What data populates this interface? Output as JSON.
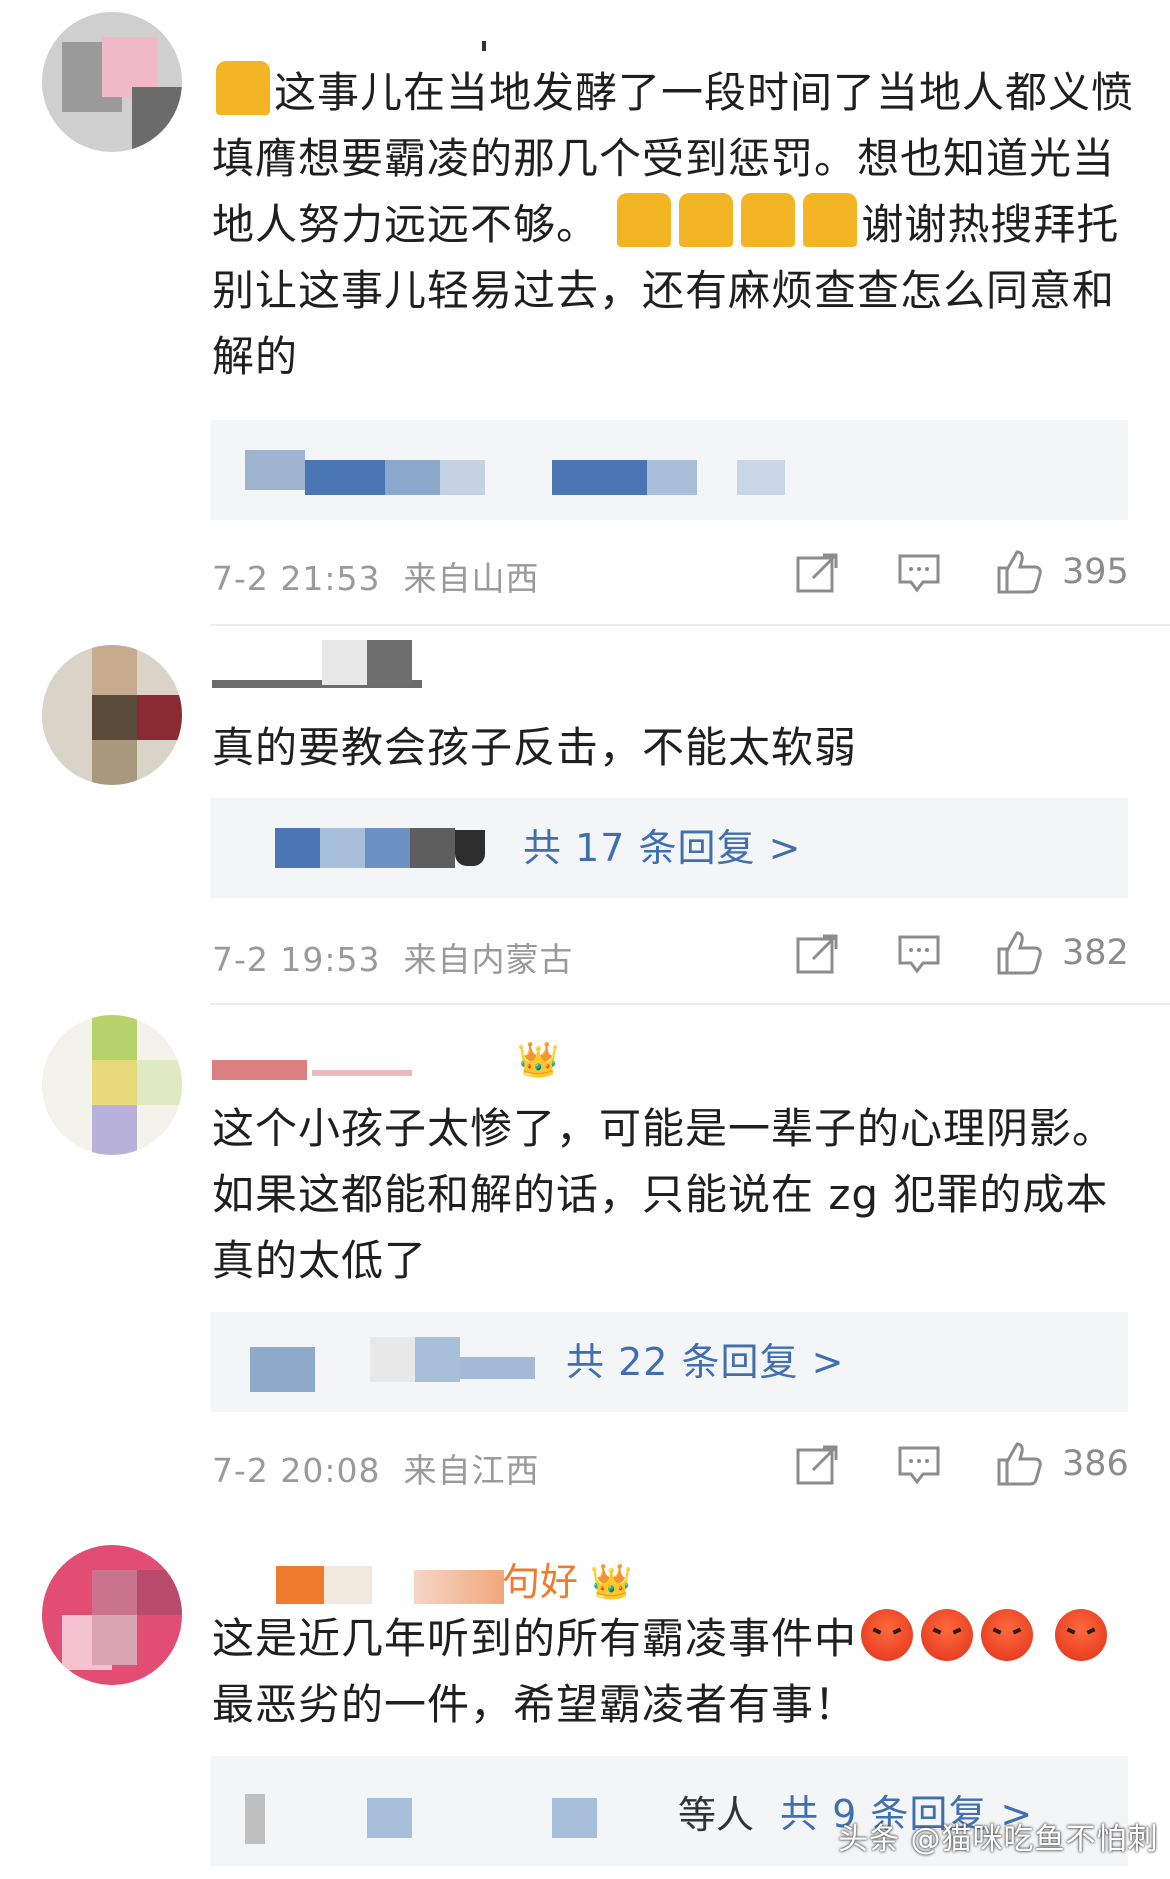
{
  "comments": [
    {
      "text_before_emoji": "",
      "text": "这事儿在当地发酵了一段时间了当地人都义愤填膺想要霸凌的那几个受到惩罚。想也知道光当地人努力远远不够。",
      "text_after": "谢谢热搜拜托别让这事儿轻易过去，还有麻烦查查怎么同意和解的",
      "reply_partial": "",
      "reply_link": "",
      "time": "7-2 21:53",
      "location": "来自山西",
      "likes": "395"
    },
    {
      "text": "真的要教会孩子反击，不能太软弱",
      "reply_link": "共 17 条回复 >",
      "time": "7-2 19:53",
      "location": "来自内蒙古",
      "likes": "382"
    },
    {
      "text": "这个小孩子太惨了，可能是一辈子的心理阴影。如果这都能和解的话，只能说在 zg 犯罪的成本真的太低了",
      "reply_link": "共 22 条回复 >",
      "time": "7-2 20:08",
      "location": "来自江西",
      "likes": "386"
    },
    {
      "username_partial": "句好",
      "text": "这是近几年听到的所有霸凌事件中",
      "text_after": "最恶劣的一件，希望霸凌者有事！",
      "reply_partial": "等人",
      "reply_link": "共 9 条回复 >",
      "time": "",
      "location": "",
      "likes": ""
    }
  ],
  "icons": {
    "share": "share-icon",
    "comment": "comment-icon",
    "like": "thumbs-up-icon",
    "pray": "pray-emoji",
    "angry": "angry-emoji",
    "crown": "crown-badge-icon"
  },
  "colors": {
    "link": "#3f6fb0",
    "meta": "#9a9a9a",
    "reply_bg": "#f4f5f7"
  },
  "watermark": "头条 @猫咪吃鱼不怕刺"
}
